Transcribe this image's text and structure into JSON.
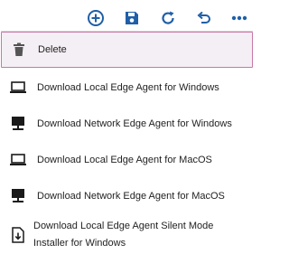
{
  "colors": {
    "toolbar_icon": "#1f5fa8",
    "menu_icon": "#1a1a1a",
    "delete_icon": "#555555",
    "active_border": "#c778a8",
    "active_bg": "#f4eff4",
    "text": "#1f1f1f"
  },
  "toolbar": {
    "buttons": [
      {
        "icon": "add-circle-icon"
      },
      {
        "icon": "save-icon"
      },
      {
        "icon": "refresh-icon"
      },
      {
        "icon": "undo-icon"
      },
      {
        "icon": "more-icon"
      }
    ]
  },
  "menu": {
    "items": [
      {
        "label": "Delete",
        "icon": "trash-icon",
        "active": true
      },
      {
        "label": "Download Local Edge Agent for Windows",
        "icon": "laptop-icon"
      },
      {
        "label": "Download Network Edge Agent for Windows",
        "icon": "network-computer-icon"
      },
      {
        "label": "Download Local Edge Agent for MacOS",
        "icon": "laptop-icon"
      },
      {
        "label": "Download Network Edge Agent for MacOS",
        "icon": "network-computer-icon"
      },
      {
        "label": "Download Local Edge Agent Silent Mode Installer for Windows",
        "icon": "file-download-icon"
      }
    ]
  }
}
